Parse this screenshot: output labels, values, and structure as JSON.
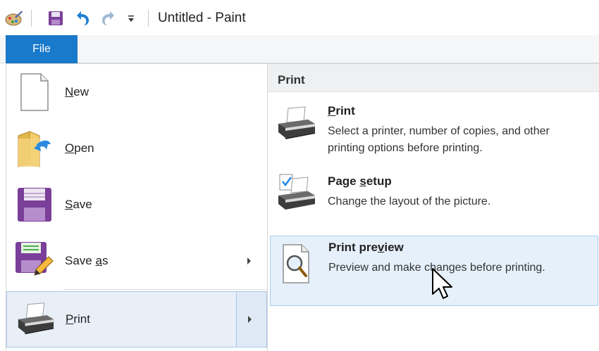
{
  "window": {
    "title": "Untitled - Paint"
  },
  "quick_access": {
    "icons": [
      "paint-app-icon",
      "save-icon",
      "undo-icon",
      "redo-icon",
      "customize-dropdown-icon"
    ]
  },
  "ribbon": {
    "file_tab": "File"
  },
  "file_menu": {
    "left_items": [
      {
        "label_pre": "",
        "label_key": "N",
        "label_post": "ew",
        "icon": "new-document-icon",
        "submenu": false
      },
      {
        "label_pre": "",
        "label_key": "O",
        "label_post": "pen",
        "icon": "open-folder-icon",
        "submenu": false
      },
      {
        "label_pre": "",
        "label_key": "S",
        "label_post": "ave",
        "icon": "save-floppy-icon",
        "submenu": false
      },
      {
        "label_pre": "Save ",
        "label_key": "a",
        "label_post": "s",
        "icon": "save-as-icon",
        "submenu": true
      },
      {
        "label_pre": "",
        "label_key": "P",
        "label_post": "rint",
        "icon": "printer-icon",
        "submenu": true
      }
    ],
    "panel": {
      "header": "Print",
      "items": [
        {
          "title_pre": "",
          "title_key": "P",
          "title_post": "rint",
          "description": "Select a printer, number of copies, and other printing options before printing.",
          "icon": "printer-icon"
        },
        {
          "title_pre": "Page ",
          "title_key": "s",
          "title_post": "etup",
          "description": "Change the layout of the picture.",
          "icon": "page-setup-icon"
        },
        {
          "title_pre": "Print pre",
          "title_key": "v",
          "title_post": "iew",
          "description": "Preview and make changes before printing.",
          "icon": "print-preview-icon"
        }
      ]
    }
  },
  "colors": {
    "file_tab_bg": "#1979ca",
    "hover_bg": "#e5f0fb",
    "hover_border": "#a8cdf0"
  }
}
